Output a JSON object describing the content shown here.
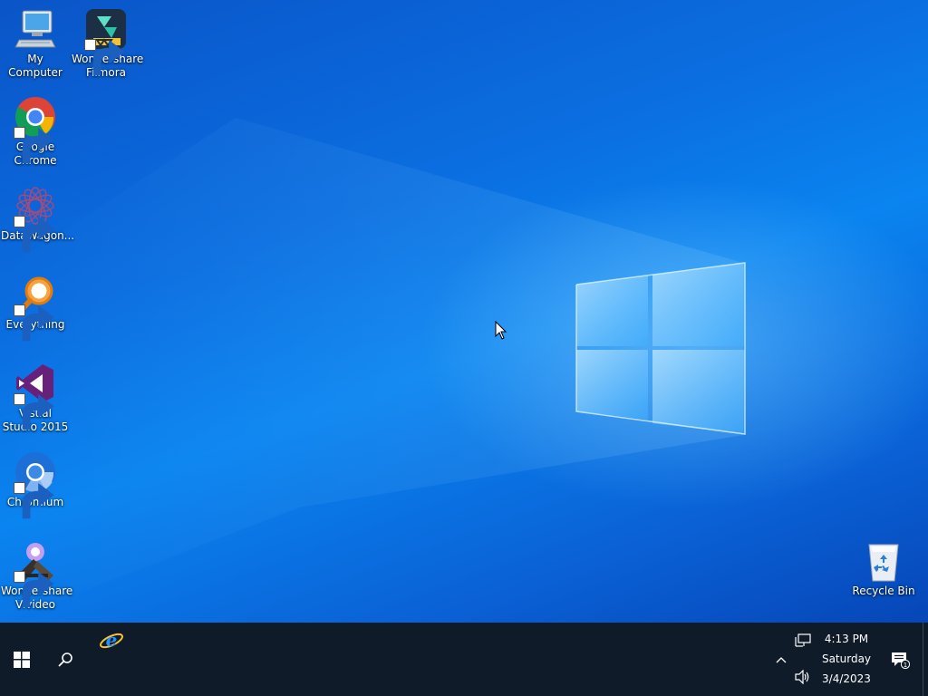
{
  "desktop": {
    "icons": [
      {
        "label": "My Computer",
        "icon": "computer-icon"
      },
      {
        "label": "Wondershare Filmora",
        "icon": "filmora-icon"
      },
      {
        "label": "Google Chrome",
        "icon": "chrome-icon"
      },
      {
        "label": "DataWagon...",
        "icon": "datawagon-icon"
      },
      {
        "label": "Everything",
        "icon": "everything-search-icon"
      },
      {
        "label": "Visual Studio 2015",
        "icon": "visual-studio-icon"
      },
      {
        "label": "Chromium",
        "icon": "chromium-icon"
      },
      {
        "label": "Wondershare Vivideo",
        "icon": "vivideo-icon"
      },
      {
        "label": "Recycle Bin",
        "icon": "recycle-bin-icon"
      }
    ]
  },
  "taskbar": {
    "start": "windows-start-icon",
    "search": "search-icon",
    "pinned": [
      {
        "name": "Internet Explorer",
        "icon": "internet-explorer-icon"
      }
    ],
    "tray": {
      "time": "4:13 PM",
      "day": "Saturday",
      "date": "3/4/2023",
      "notification_count": "1"
    }
  },
  "colors": {
    "taskbar": "#101b2a",
    "desktop_accent": "#0a84f0"
  }
}
